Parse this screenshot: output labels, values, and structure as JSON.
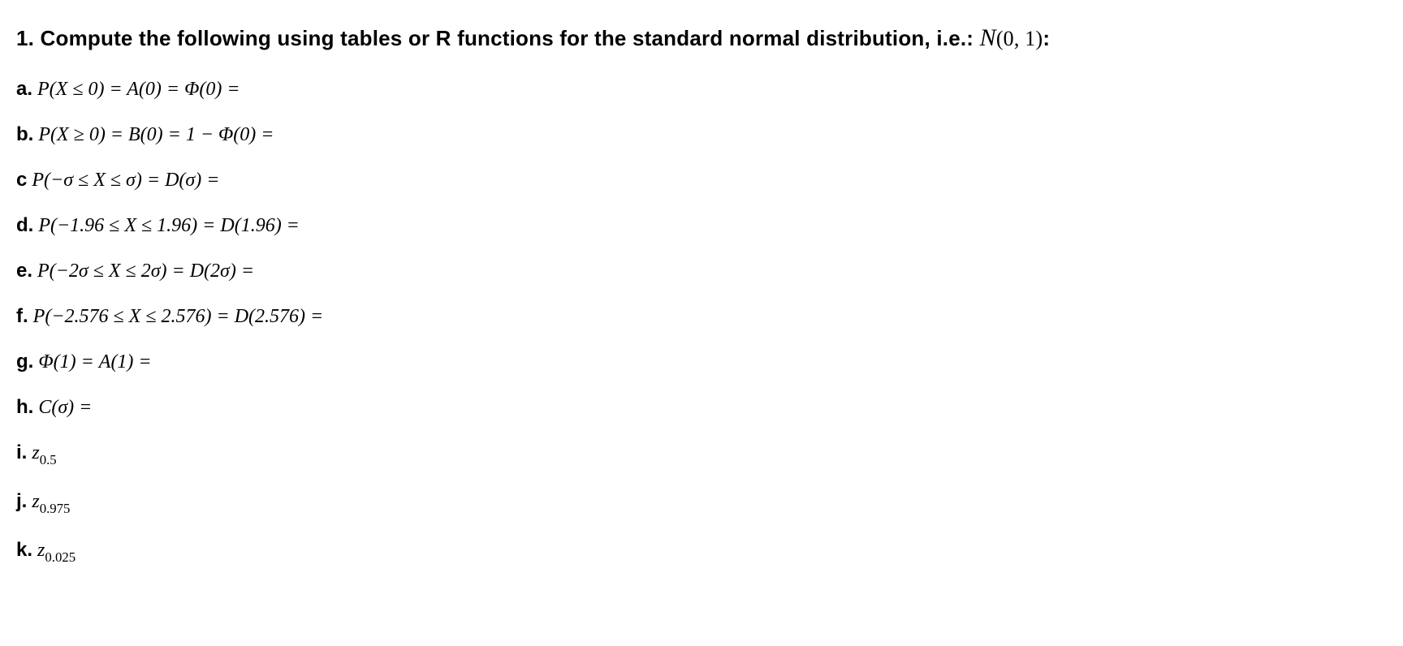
{
  "title": {
    "number": "1.",
    "text": "Compute the following using tables or R functions for the standard normal distribution, i.e.:",
    "distribution_open": "(0, 1)",
    "colon": ":"
  },
  "items": [
    {
      "label": "a.",
      "expr": "P(X ≤ 0) = A(0) = Φ(0) ="
    },
    {
      "label": "b.",
      "expr": "P(X ≥ 0) = B(0) = 1 − Φ(0) ="
    },
    {
      "label": "c",
      "expr": "P(−σ ≤ X ≤ σ) = D(σ) ="
    },
    {
      "label": "d.",
      "expr": "P(−1.96 ≤ X ≤ 1.96) = D(1.96) ="
    },
    {
      "label": "e.",
      "expr": "P(−2σ ≤ X ≤ 2σ) = D(2σ) ="
    },
    {
      "label": "f.",
      "expr": "P(−2.576 ≤ X ≤ 2.576) = D(2.576) ="
    },
    {
      "label": "g.",
      "expr": "Φ(1) = A(1) ="
    },
    {
      "label": "h.",
      "expr": "C(σ) ="
    },
    {
      "label": "i.",
      "expr_base": "z",
      "expr_sub": "0.5"
    },
    {
      "label": "j.",
      "expr_base": "z",
      "expr_sub": "0.975"
    },
    {
      "label": "k.",
      "expr_base": "z",
      "expr_sub": "0.025"
    }
  ]
}
